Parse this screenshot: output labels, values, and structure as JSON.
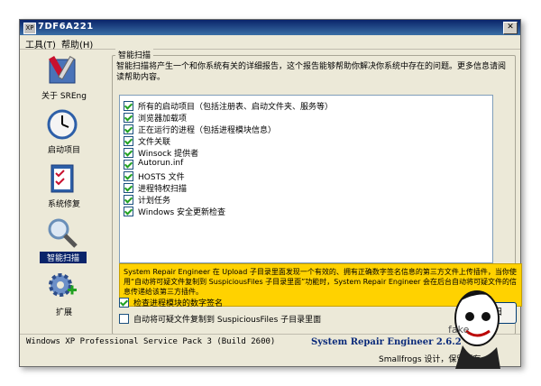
{
  "window": {
    "title": "7DF6A221",
    "close_glyph": "✕",
    "icon_label": "XP"
  },
  "menu": [
    {
      "label": "工具(T)"
    },
    {
      "label": "帮助(H)"
    }
  ],
  "sidebar": {
    "items": [
      {
        "label": "关于 SREng",
        "icon": "tools-icon"
      },
      {
        "label": "启动项目",
        "icon": "clock-icon"
      },
      {
        "label": "系统修复",
        "icon": "checklist-icon"
      },
      {
        "label": "智能扫描",
        "icon": "magnifier-icon",
        "active": true
      },
      {
        "label": "扩展",
        "icon": "gear-plus-icon"
      }
    ]
  },
  "main": {
    "group_title": "智能扫描",
    "description": "智能扫描将产生一个和你系统有关的详细报告，这个报告能够帮助你解决你系统中存在的问题。更多信息请阅读帮助内容。",
    "scan_items": [
      {
        "label": "所有的启动项目（包括注册表、启动文件夹、服务等）",
        "checked": true
      },
      {
        "label": "浏览器加载项",
        "checked": true
      },
      {
        "label": "正在运行的进程（包括进程模块信息）",
        "checked": true
      },
      {
        "label": "文件关联",
        "checked": true
      },
      {
        "label": "Winsock 提供者",
        "checked": true
      },
      {
        "label": "Autorun.inf",
        "checked": true
      },
      {
        "label": "HOSTS 文件",
        "checked": true
      },
      {
        "label": "进程特权扫描",
        "checked": true
      },
      {
        "label": "计划任务",
        "checked": true
      },
      {
        "label": "Windows 安全更新检查",
        "checked": true
      }
    ],
    "warning": "System Repair Engineer 在 Upload 子目录里面发现一个有效的、拥有正确数字签名信息的第三方文件上传插件，当你使用“自动将可疑文件复制到 SuspiciousFiles 子目录里面”功能时，System Repair Engineer 会在后台自动将可疑文件的信息传递给该第三方插件。",
    "options": [
      {
        "label": "检查进程模块的数字签名",
        "checked": true
      },
      {
        "label": "自动将可疑文件复制到 SuspiciousFiles 子目录里面",
        "checked": false
      }
    ],
    "scan_button": "扫",
    "watermark": "fake"
  },
  "status": {
    "os": "Windows XP Professional Service Pack 3 (Build 2600)",
    "product": "System Repair Engineer 2.6.2",
    "credit": "Smallfrogs 设计，保留所有"
  }
}
